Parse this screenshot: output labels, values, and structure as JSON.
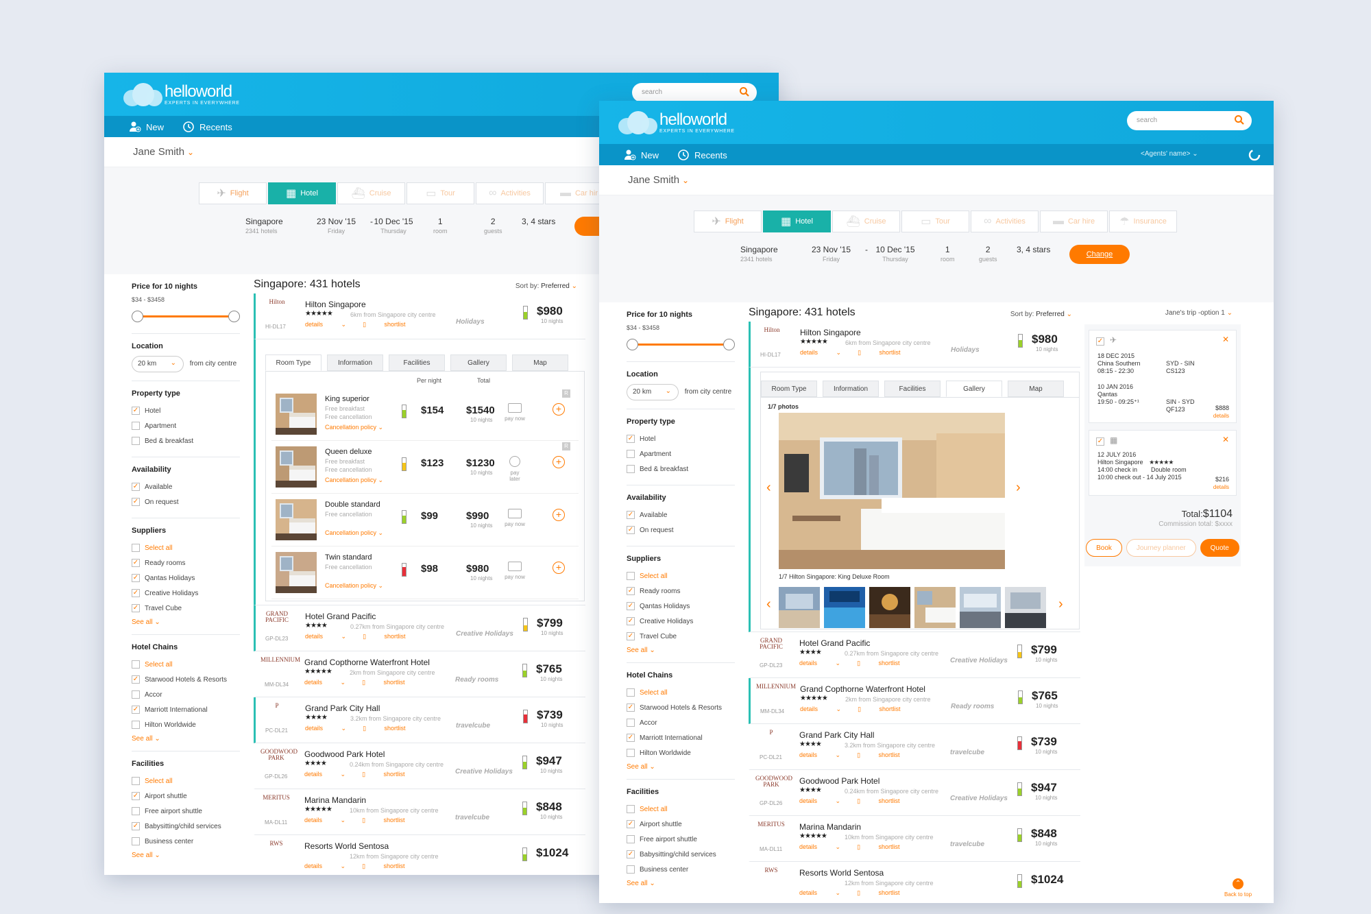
{
  "brand": {
    "name": "helloworld",
    "tagline": "EXPERTS IN EVERYWHERE"
  },
  "search": {
    "placeholder": "search"
  },
  "nav": {
    "new": "New",
    "recents": "Recents",
    "agent": "<Agents' name>"
  },
  "user": "Jane Smith",
  "tabs": [
    {
      "label": "Flight",
      "icon": "plane-icon"
    },
    {
      "label": "Hotel",
      "icon": "hotel-icon"
    },
    {
      "label": "Cruise",
      "icon": "ship-icon"
    },
    {
      "label": "Tour",
      "icon": "bus-icon"
    },
    {
      "label": "Activities",
      "icon": "binoculars-icon"
    },
    {
      "label": "Car hire",
      "icon": "car-icon"
    },
    {
      "label": "Insurance",
      "icon": "umbrella-icon"
    }
  ],
  "tabs_back_last": "Car hir",
  "trip": {
    "city": "Singapore",
    "city_sub": "2341 hotels",
    "from": "23 Nov '15",
    "from_sub": "Friday",
    "dash": "-",
    "to": "10 Dec '15",
    "to_sub": "Thursday",
    "rooms": "1",
    "rooms_sub": "room",
    "guests": "2",
    "guests_sub": "guests",
    "stars": "3, 4 stars",
    "change": "Change",
    "change_back": "C"
  },
  "filters": {
    "price_title": "Price for 10 nights",
    "price_range": "$34 - $3458",
    "location_title": "Location",
    "location_value": "20 km",
    "location_suffix": "from city centre",
    "property_title": "Property type",
    "property": [
      {
        "label": "Hotel",
        "checked": true
      },
      {
        "label": "Apartment",
        "checked": false
      },
      {
        "label": "Bed & breakfast",
        "checked": false
      }
    ],
    "availability_title": "Availability",
    "availability": [
      {
        "label": "Available",
        "checked": true
      },
      {
        "label": "On request",
        "checked": true
      }
    ],
    "suppliers_title": "Suppliers",
    "suppliers": [
      {
        "label": "Select all",
        "checked": false,
        "orange": true
      },
      {
        "label": "Ready rooms",
        "checked": true
      },
      {
        "label": "Qantas Holidays",
        "checked": true
      },
      {
        "label": "Creative Holidays",
        "checked": true
      },
      {
        "label": "Travel Cube",
        "checked": true
      }
    ],
    "chains_title": "Hotel Chains",
    "chains": [
      {
        "label": "Select all",
        "checked": false,
        "orange": true
      },
      {
        "label": "Starwood Hotels & Resorts",
        "checked": true
      },
      {
        "label": "Accor",
        "checked": false
      },
      {
        "label": "Marriott International",
        "checked": true
      },
      {
        "label": "Hilton Worldwide",
        "checked": false
      }
    ],
    "facilities_title": "Facilities",
    "facilities": [
      {
        "label": "Select all",
        "checked": false,
        "orange": true
      },
      {
        "label": "Airport shuttle",
        "checked": true
      },
      {
        "label": "Free airport shuttle",
        "checked": false
      },
      {
        "label": "Babysitting/child services",
        "checked": true
      },
      {
        "label": "Business center",
        "checked": false
      }
    ],
    "see_all": "See all"
  },
  "results": {
    "title": "Singapore: 431 hotels",
    "sort_label": "Sort by:",
    "sort_value": "Preferred"
  },
  "hotels": [
    {
      "name": "Hilton Singapore",
      "stars": "★★★★★",
      "dist": "6km from Singapore city centre",
      "code": "HI-DL17",
      "supplier": "Holidays",
      "price": "$980",
      "nights": "10 nights",
      "logo": "Hilton",
      "level": 0.55,
      "color": "#9bd12a"
    },
    {
      "name": "Hotel Grand Pacific",
      "stars": "★★★★",
      "dist": "0.27km from Singapore city centre",
      "code": "GP-DL23",
      "supplier": "Creative Holidays",
      "price": "$799",
      "nights": "10 nights",
      "logo": "GRAND PACIFIC",
      "level": 0.45,
      "color": "#f5c518"
    },
    {
      "name": "Grand Copthorne Waterfront Hotel",
      "stars": "★★★★★",
      "dist": "2km from Singapore city centre",
      "code": "MM-DL34",
      "supplier": "Ready rooms",
      "price": "$765",
      "nights": "10 nights",
      "logo": "MILLENNIUM",
      "level": 0.5,
      "color": "#9bd12a"
    },
    {
      "name": "Grand Park City Hall",
      "stars": "★★★★",
      "dist": "3.2km from Singapore city centre",
      "code": "PC-DL21",
      "supplier": "travelcube",
      "price": "$739",
      "nights": "10 nights",
      "logo": "P",
      "level": 0.65,
      "color": "#e8303a"
    },
    {
      "name": "Goodwood Park Hotel",
      "stars": "★★★★",
      "dist": "0.24km from Singapore city centre",
      "code": "GP-DL26",
      "supplier": "Creative Holidays",
      "price": "$947",
      "nights": "10 nights",
      "logo": "GOODWOOD PARK",
      "level": 0.55,
      "color": "#9bd12a"
    },
    {
      "name": "Marina Mandarin",
      "stars": "★★★★★",
      "dist": "10km from Singapore city centre",
      "code": "MA-DL11",
      "supplier": "travelcube",
      "price": "$848",
      "nights": "10 nights",
      "logo": "MERITUS",
      "level": 0.55,
      "color": "#9bd12a"
    },
    {
      "name": "Resorts World Sentosa",
      "stars": "",
      "dist": "12km from Singapore city centre",
      "code": "",
      "supplier": "",
      "price": "$1024",
      "nights": "",
      "logo": "RWS",
      "level": 0.5,
      "color": "#9bd12a"
    }
  ],
  "hotel_links": {
    "details": "details",
    "shortlist": "shortlist"
  },
  "detail_tabs": [
    "Room Type",
    "Information",
    "Facilities",
    "Gallery",
    "Map"
  ],
  "rooms": {
    "per_night": "Per night",
    "total": "Total",
    "items": [
      {
        "name": "King superior",
        "sub1": "Free breakfast",
        "sub2": "Free cancellation",
        "policy": "Cancellation policy",
        "pn": "$154",
        "total": "$1540",
        "nights": "10 nights",
        "pay": "pay now",
        "level": 0.6,
        "color": "#9bd12a",
        "badge": "R"
      },
      {
        "name": "Queen deluxe",
        "sub1": "Free breakfast",
        "sub2": "Free cancellation",
        "policy": "Cancellation policy",
        "pn": "$123",
        "total": "$1230",
        "nights": "10 nights",
        "pay": "pay later",
        "level": 0.6,
        "color": "#f5c518",
        "badge": "R"
      },
      {
        "name": "Double standard",
        "sub1": "Free cancellation",
        "sub2": "",
        "policy": "Cancellation policy",
        "pn": "$99",
        "total": "$990",
        "nights": "10 nights",
        "pay": "pay now",
        "level": 0.6,
        "color": "#9bd12a",
        "badge": ""
      },
      {
        "name": "Twin standard",
        "sub1": "Free cancellation",
        "sub2": "",
        "policy": "Cancellation policy",
        "pn": "$98",
        "total": "$980",
        "nights": "10 nights",
        "pay": "pay now",
        "level": 0.7,
        "color": "#e8303a",
        "badge": ""
      }
    ]
  },
  "gallery": {
    "count": "1/7 photos",
    "caption": "1/7 Hilton Singapore: King Deluxe Room"
  },
  "trip_panel": {
    "title": "Jane's trip -option 1",
    "flight": {
      "date1": "18 DEC 2015",
      "airline1": "China Southern",
      "time1": "08:15 - 22:30",
      "route1": "SYD - SIN",
      "code1": "CS123",
      "date2": "10 JAN 2016",
      "airline2": "Qantas",
      "time2": "19:50 - 09:25⁺¹",
      "route2": "SIN - SYD",
      "code2": "QF123",
      "price": "$888",
      "details": "details"
    },
    "hotel": {
      "date": "12 JULY 2016",
      "name": "Hilton Singapore",
      "stars": "★★★★★",
      "in": "14:00 check in",
      "room": "Double room",
      "out": "10:00 check out - 14 July 2015",
      "price": "$216",
      "details": "details"
    },
    "total_label": "Total:",
    "total": "$1104",
    "commission": "Commission total: $xxxx",
    "book": "Book",
    "journey": "Journey planner",
    "quote": "Quote"
  },
  "back_to_top": "Back to top",
  "colors": {
    "brand": "#16b5e8",
    "accent": "#ff7a00",
    "teal": "#19b1a8"
  }
}
